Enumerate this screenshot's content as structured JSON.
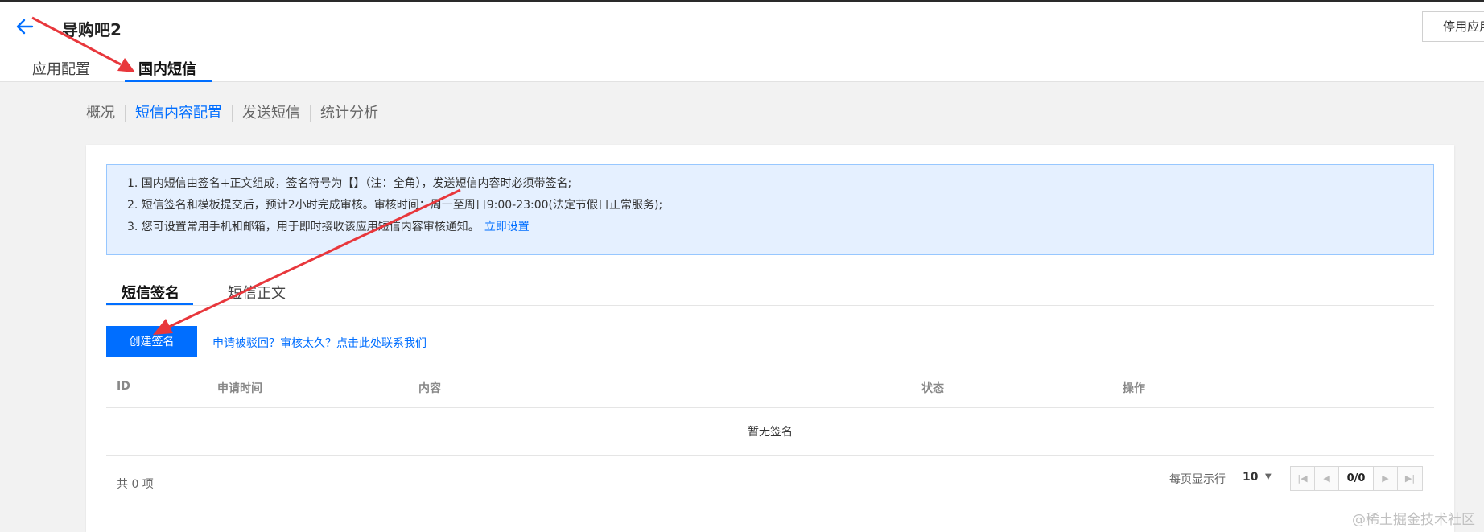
{
  "header": {
    "back_icon": "arrow-left-icon",
    "app_title": "导购吧2",
    "stop_button": "停用应用",
    "tabs": [
      {
        "label": "应用配置",
        "active": false
      },
      {
        "label": "国内短信",
        "active": true
      }
    ]
  },
  "subnav": {
    "items": [
      {
        "label": "概况",
        "active": false
      },
      {
        "label": "短信内容配置",
        "active": true
      },
      {
        "label": "发送短信",
        "active": false
      },
      {
        "label": "统计分析",
        "active": false
      }
    ]
  },
  "notice": {
    "line1": "1. 国内短信由签名+正文组成，签名符号为【】（注：全角），发送短信内容时必须带签名;",
    "line2": "2. 短信签名和模板提交后，预计2小时完成审核。审核时间：周一至周日9:00-23:00(法定节假日正常服务);",
    "line3": "3. 您可设置常用手机和邮箱，用于即时接收该应用短信内容审核通知。",
    "line3_link": "立即设置"
  },
  "content_tabs": [
    {
      "label": "短信签名",
      "active": true
    },
    {
      "label": "短信正文",
      "active": false
    }
  ],
  "actions": {
    "create_button": "创建签名",
    "contact_link": "申请被驳回？审核太久？点击此处联系我们"
  },
  "table": {
    "columns": [
      "ID",
      "申请时间",
      "内容",
      "状态",
      "操作"
    ],
    "rows": [],
    "empty_text": "暂无签名"
  },
  "pagination": {
    "total": "共 0 项",
    "page_size_label": "每页显示行",
    "page_size": "10",
    "current": "0/0",
    "icons": [
      "first-page-icon",
      "prev-page-icon",
      "next-page-icon",
      "last-page-icon"
    ]
  },
  "watermark": "@稀土掘金技术社区",
  "colors": {
    "accent": "#006eff",
    "notice_bg": "#e5f0ff",
    "notice_border": "#97c7ff",
    "annotation_arrow": "#e8373c"
  }
}
